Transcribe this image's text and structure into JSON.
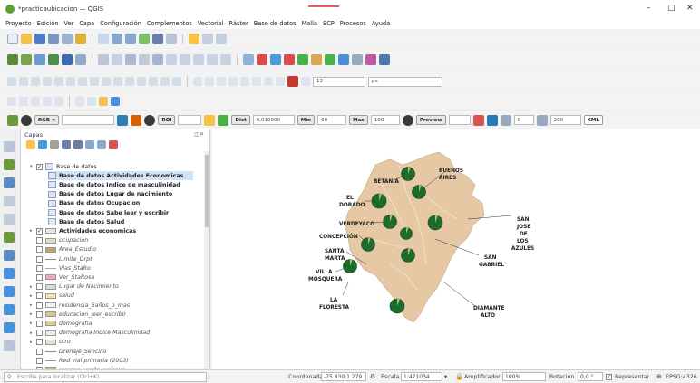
{
  "window": {
    "title": "*practicaubicacion — QGIS",
    "minimize": "–",
    "maximize": "□",
    "close": "✕"
  },
  "menu": [
    "Proyecto",
    "Edición",
    "Ver",
    "Capa",
    "Configuración",
    "Complementos",
    "Vectorial",
    "Ráster",
    "Base de datos",
    "Malla",
    "SCP",
    "Procesos",
    "Ayuda"
  ],
  "toolbar4": {
    "rgb_label": "RGB =",
    "roi_label": "ROI",
    "dist_label": "Dist",
    "dist_value": "0,010000",
    "min_label": "Min",
    "min_value": "60",
    "max_label": "Max",
    "max_value": "100",
    "preview_label": "Preview",
    "band_value": "0",
    "size_value": "200",
    "kml_label": "KML",
    "zoom_value": "12",
    "px_label": "px"
  },
  "panel": {
    "title": "Capas"
  },
  "layers": [
    {
      "label": "Base de datos",
      "style": "normal",
      "indent": 1,
      "type": "group",
      "checked": "✓",
      "arrow": "▾"
    },
    {
      "label": "Base de datos Actividades Economicas",
      "style": "bold",
      "indent": 2,
      "type": "table",
      "selected": true
    },
    {
      "label": "Base de datos Indice de masculinidad",
      "style": "bold",
      "indent": 2,
      "type": "table"
    },
    {
      "label": "Base de datos Lugar de nacimiento",
      "style": "bold",
      "indent": 2,
      "type": "table"
    },
    {
      "label": "Base de datos Ocupacion",
      "style": "bold",
      "indent": 2,
      "type": "table"
    },
    {
      "label": "Base de datos Sabe leer y escribir",
      "style": "bold",
      "indent": 2,
      "type": "table"
    },
    {
      "label": "Base de datos Salud",
      "style": "bold",
      "indent": 2,
      "type": "table"
    },
    {
      "label": "Actividades economicas",
      "style": "bold",
      "indent": 1,
      "type": "poly",
      "color": "#e8e8e8",
      "checked": "✓",
      "arrow": "▸"
    },
    {
      "label": "ocupacion",
      "style": "ital",
      "indent": 1,
      "type": "poly",
      "color": "#d7e6c1"
    },
    {
      "label": "Area_Estudio",
      "style": "ital",
      "indent": 1,
      "type": "poly",
      "color": "#c7a36a"
    },
    {
      "label": "Limite_Drpt",
      "style": "ital",
      "indent": 1,
      "type": "line",
      "color": "#888888"
    },
    {
      "label": "Vias_StaRo",
      "style": "ital",
      "indent": 1,
      "type": "line",
      "color": "#aaaaaa"
    },
    {
      "label": "Ver_StaRosa",
      "style": "ital",
      "indent": 1,
      "type": "poly",
      "color": "#f2a7b8"
    },
    {
      "label": "Lugar de Nacimiento",
      "style": "ital",
      "indent": 1,
      "type": "poly",
      "color": "#d9d9d9",
      "arrow": "▸"
    },
    {
      "label": "salud",
      "style": "ital",
      "indent": 1,
      "type": "poly",
      "color": "#f0e6a0",
      "arrow": "▸"
    },
    {
      "label": "residencia_5años_o_mas",
      "style": "ital",
      "indent": 1,
      "type": "poly",
      "color": "#f4f4f4",
      "arrow": "▸"
    },
    {
      "label": "educacion_leer_escribir",
      "style": "ital",
      "indent": 1,
      "type": "poly",
      "color": "#d8c98a",
      "arrow": "▸"
    },
    {
      "label": "demografia",
      "style": "ital",
      "indent": 1,
      "type": "poly",
      "color": "#e6d08a",
      "arrow": "▸"
    },
    {
      "label": "demografia Indice Masculinidad",
      "style": "ital",
      "indent": 1,
      "type": "poly",
      "color": "#eaeaea",
      "arrow": "▸"
    },
    {
      "label": "otro",
      "style": "ital",
      "indent": 1,
      "type": "poly",
      "color": "#e6e0d0",
      "arrow": "▸"
    },
    {
      "label": "Drenaje_Sencillo",
      "style": "ital",
      "indent": 1,
      "type": "line",
      "color": "#888888"
    },
    {
      "label": "Red vial primaria (2003)",
      "style": "ital",
      "indent": 1,
      "type": "line",
      "color": "#999999"
    },
    {
      "label": "reserva_verde_oxigeno",
      "style": "ital",
      "indent": 1,
      "type": "poly",
      "color": "#b7c98a"
    }
  ],
  "map_labels": {
    "betania": "BETANIA",
    "buenos_aires": [
      "BUENOS",
      "AIRES"
    ],
    "el_dorado": [
      "EL",
      "DORADO"
    ],
    "verdeyaco": "VERDEYACO",
    "concepcion": "CONCEPCIÓN",
    "santa_marta": [
      "SANTA",
      "MARTA"
    ],
    "villa_mosquera": [
      "VILLA",
      "MOSQUERA"
    ],
    "la_floresta": [
      "LA",
      "FLORESTA"
    ],
    "san_jose": [
      "SAN",
      "JOSE",
      "DE",
      "LOS",
      "AZULES"
    ],
    "san_gabriel": [
      "SAN",
      "GABRIEL"
    ],
    "diamante_alto": [
      "DIAMANTE",
      "ALTO"
    ]
  },
  "colors": {
    "polygon": "#e6c8a4",
    "pie": "#1f6b2c",
    "pie_light": "#a3c96a",
    "accent_toolbar": "#2a7ab8"
  },
  "status": {
    "locator_placeholder": "Escriba para localizar (Ctrl+K)",
    "coord_label": "Coordenada",
    "coord_value": "-75.830,1.279",
    "scale_label": "Escala",
    "scale_value": "1:471034",
    "magnifier_label": "Amplificador",
    "magnifier_value": "100%",
    "rotation_label": "Rotación",
    "rotation_value": "0,0 °",
    "render_label": "Representar",
    "crs_label": "EPSG:4326"
  }
}
